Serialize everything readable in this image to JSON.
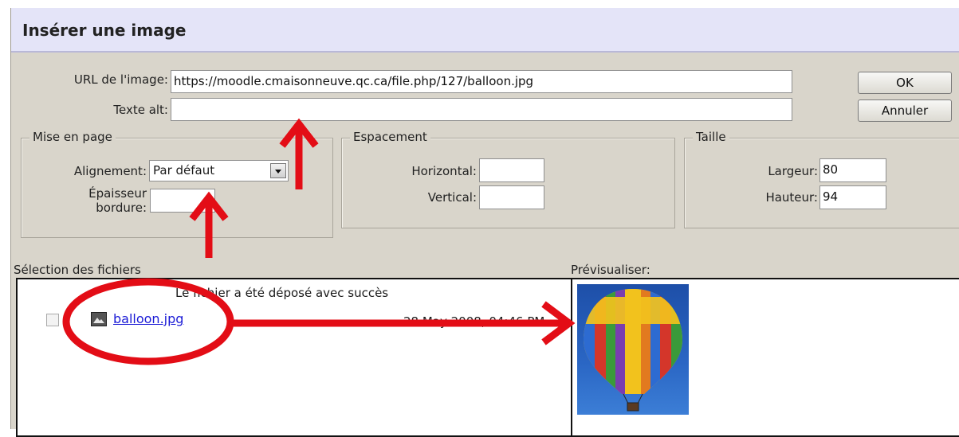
{
  "dialog": {
    "title": "Insérer une image",
    "url_label": "URL de l'image:",
    "url_value": "https://moodle.cmaisonneuve.qc.ca/file.php/127/balloon.jpg",
    "alt_label": "Texte alt:",
    "alt_value": "",
    "ok_label": "OK",
    "cancel_label": "Annuler"
  },
  "layout_group": {
    "legend": "Mise en page",
    "align_label": "Alignement:",
    "align_value": "Par défaut",
    "border_label_1": "Épaisseur",
    "border_label_2": "bordure:",
    "border_value": ""
  },
  "spacing_group": {
    "legend": "Espacement",
    "horizontal_label": "Horizontal:",
    "horizontal_value": "",
    "vertical_label": "Vertical:",
    "vertical_value": ""
  },
  "size_group": {
    "legend": "Taille",
    "width_label": "Largeur:",
    "width_value": "80",
    "height_label": "Hauteur:",
    "height_value": "94"
  },
  "files": {
    "header": "Sélection des fichiers",
    "status": "Le fichier a été déposé avec succès",
    "items": [
      {
        "name": "balloon.jpg",
        "date": "28 May 2008, 04:46 PM",
        "icon": "image-file-icon"
      }
    ]
  },
  "preview": {
    "header": "Prévisualiser:",
    "image": "hot-air-balloon-image"
  },
  "annotations": {
    "color": "#e30d16"
  }
}
